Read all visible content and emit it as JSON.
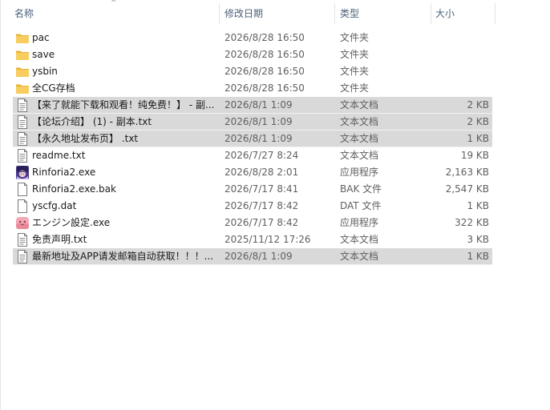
{
  "columns": {
    "name": "名称",
    "date": "修改日期",
    "type": "类型",
    "size": "大小",
    "sort_indicator": "^"
  },
  "files": [
    {
      "name": "pac",
      "date": "2026/8/28 16:50",
      "type": "文件夹",
      "size": "",
      "icon": "folder-icon",
      "selected": false
    },
    {
      "name": "save",
      "date": "2026/8/28 16:50",
      "type": "文件夹",
      "size": "",
      "icon": "folder-icon",
      "selected": false
    },
    {
      "name": "ysbin",
      "date": "2026/8/28 16:50",
      "type": "文件夹",
      "size": "",
      "icon": "folder-icon",
      "selected": false
    },
    {
      "name": "全CG存档",
      "date": "2026/8/28 16:50",
      "type": "文件夹",
      "size": "",
      "icon": "folder-icon",
      "selected": false
    },
    {
      "name": "【来了就能下载和观看！纯免费！】 - 副...",
      "date": "2026/8/1 1:09",
      "type": "文本文档",
      "size": "2 KB",
      "icon": "text-file-icon",
      "selected": true
    },
    {
      "name": "【论坛介绍】 (1) - 副本.txt",
      "date": "2026/8/1 1:09",
      "type": "文本文档",
      "size": "2 KB",
      "icon": "text-file-icon",
      "selected": true
    },
    {
      "name": "【永久地址发布页】 .txt",
      "date": "2026/8/1 1:09",
      "type": "文本文档",
      "size": "1 KB",
      "icon": "text-file-icon",
      "selected": true
    },
    {
      "name": "readme.txt",
      "date": "2026/7/27 8:24",
      "type": "文本文档",
      "size": "19 KB",
      "icon": "text-file-icon",
      "selected": false
    },
    {
      "name": "Rinforia2.exe",
      "date": "2026/8/28 2:01",
      "type": "应用程序",
      "size": "2,163 KB",
      "icon": "app-character-icon",
      "selected": false
    },
    {
      "name": "Rinforia2.exe.bak",
      "date": "2026/7/17 8:41",
      "type": "BAK 文件",
      "size": "2,547 KB",
      "icon": "blank-file-icon",
      "selected": false
    },
    {
      "name": "yscfg.dat",
      "date": "2026/7/17 8:42",
      "type": "DAT 文件",
      "size": "1 KB",
      "icon": "blank-file-icon",
      "selected": false
    },
    {
      "name": "エンジン設定.exe",
      "date": "2026/7/17 8:42",
      "type": "应用程序",
      "size": "322 KB",
      "icon": "app-pink-icon",
      "selected": false
    },
    {
      "name": "免责声明.txt",
      "date": "2025/11/12 17:26",
      "type": "文本文档",
      "size": "3 KB",
      "icon": "text-file-icon",
      "selected": false
    },
    {
      "name": "最新地址及APP请发邮箱自动获取！！！...",
      "date": "2026/8/1 1:09",
      "type": "文本文档",
      "size": "1 KB",
      "icon": "text-file-icon",
      "selected": true
    }
  ],
  "colors": {
    "selection": "#d9d9d9",
    "header_text": "#4c607a",
    "folder": "#f6c75a"
  }
}
